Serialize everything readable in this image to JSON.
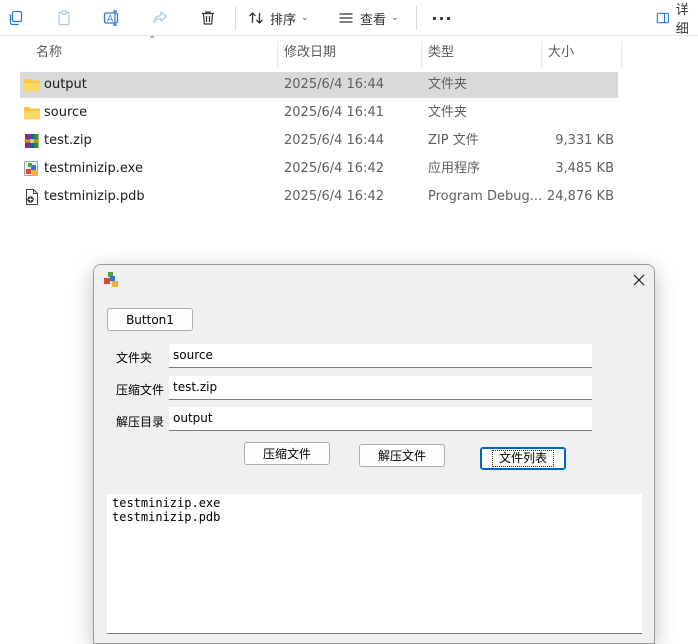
{
  "toolbar": {
    "sort_label": "排序",
    "view_label": "查看",
    "details_label": "详细"
  },
  "columns": {
    "name": "名称",
    "modified": "修改日期",
    "type": "类型",
    "size": "大小"
  },
  "files": [
    {
      "name": "output",
      "modified": "2025/6/4 16:44",
      "type": "文件夹",
      "size": "",
      "icon": "folder-icon",
      "selected": true
    },
    {
      "name": "source",
      "modified": "2025/6/4 16:41",
      "type": "文件夹",
      "size": "",
      "icon": "folder-icon",
      "selected": false
    },
    {
      "name": "test.zip",
      "modified": "2025/6/4 16:44",
      "type": "ZIP 文件",
      "size": "9,331 KB",
      "icon": "winrar-archive-icon",
      "selected": false
    },
    {
      "name": "testminizip.exe",
      "modified": "2025/6/4 16:42",
      "type": "应用程序",
      "size": "3,485 KB",
      "icon": "exe-app-icon",
      "selected": false
    },
    {
      "name": "testminizip.pdb",
      "modified": "2025/6/4 16:42",
      "type": "Program Debug...",
      "size": "24,876 KB",
      "icon": "pdb-file-icon",
      "selected": false
    }
  ],
  "dialog": {
    "button1_label": "Button1",
    "folder_label": "文件夹",
    "folder_value": "source",
    "archive_label": "压缩文件",
    "archive_value": "test.zip",
    "extract_label": "解压目录",
    "extract_value": "output",
    "compress_button": "压缩文件",
    "decompress_button": "解压文件",
    "list_button": "文件列表",
    "list_items": [
      "testminizip.exe",
      "testminizip.pdb"
    ]
  },
  "colors": {
    "folder": "#f8c642",
    "selection": "#d9d9d9",
    "accent": "#0067c0"
  }
}
